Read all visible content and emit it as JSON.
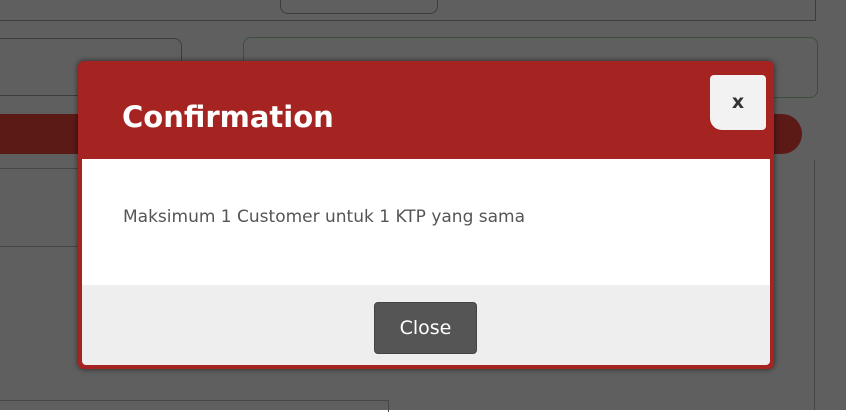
{
  "modal": {
    "title": "Confirmation",
    "close_icon_label": "x",
    "message": "Maksimum 1 Customer untuk 1 KTP yang sama",
    "close_button_label": "Close"
  },
  "colors": {
    "header": "#a52421",
    "close_button": "#555555",
    "footer": "#eeeeee",
    "overlay": "#5f5f5f"
  }
}
